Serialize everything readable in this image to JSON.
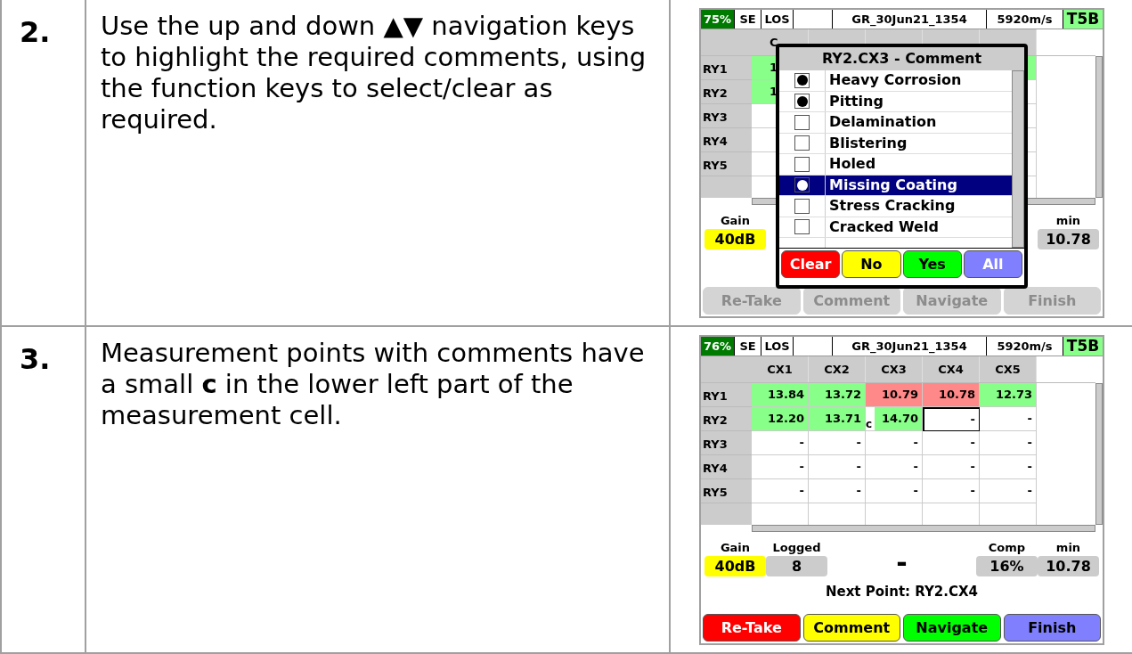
{
  "steps": [
    {
      "number": "2.",
      "text": "Use the up and down ▲▼ navigation keys to highlight the required comments, using the function keys to select/clear as required.",
      "screen": {
        "status": {
          "battery": "75%",
          "mode": "SE",
          "probe": "LOS",
          "file": "GR_30Jun21_1354",
          "velocity": "5920m/s",
          "transducer": "T5B"
        },
        "columns": [
          "C"
        ],
        "rows": [
          {
            "label": "RY1",
            "cells": [
              {
                "value": "1",
                "color": "#88ff88"
              },
              {},
              {},
              {},
              {
                "color": "#88ff88"
              }
            ]
          },
          {
            "label": "RY2",
            "cells": [
              {
                "value": "1",
                "color": "#88ff88"
              }
            ]
          },
          {
            "label": "RY3",
            "cells": []
          },
          {
            "label": "RY4",
            "cells": []
          },
          {
            "label": "RY5",
            "cells": []
          }
        ],
        "stats": [
          {
            "kind": "gain",
            "label": "Gain",
            "value": "40dB"
          },
          {
            "kind": "value",
            "label": "min",
            "value": "10.78"
          }
        ],
        "modal": {
          "title": "RY2.CX3 - Comment",
          "items": [
            {
              "label": "Heavy Corrosion",
              "checked": true,
              "selected": false
            },
            {
              "label": "Pitting",
              "checked": true,
              "selected": false
            },
            {
              "label": "Delamination",
              "checked": false,
              "selected": false
            },
            {
              "label": "Blistering",
              "checked": false,
              "selected": false
            },
            {
              "label": "Holed",
              "checked": false,
              "selected": false
            },
            {
              "label": "Missing Coating",
              "checked": true,
              "selected": true
            },
            {
              "label": "Stress Cracking",
              "checked": false,
              "selected": false
            },
            {
              "label": "Cracked Weld",
              "checked": false,
              "selected": false
            }
          ],
          "buttons": [
            {
              "label": "Clear",
              "kind": "danger"
            },
            {
              "label": "No",
              "kind": "warning"
            },
            {
              "label": "Yes",
              "kind": "confirm"
            },
            {
              "label": "All",
              "kind": "accent"
            }
          ]
        },
        "buttons": [
          {
            "label": "Re-Take",
            "disabled": true
          },
          {
            "label": "Comment",
            "disabled": true
          },
          {
            "label": "Navigate",
            "disabled": true
          },
          {
            "label": "Finish",
            "disabled": true
          }
        ]
      }
    },
    {
      "number": "3.",
      "text": "Measurement points with comments have a small **c** in the lower left part of the measurement cell.",
      "screen": {
        "status": {
          "battery": "76%",
          "mode": "SE",
          "probe": "LOS",
          "file": "GR_30Jun21_1354",
          "velocity": "5920m/s",
          "transducer": "T5B"
        },
        "columns": [
          "CX1",
          "CX2",
          "CX3",
          "CX4",
          "CX5"
        ],
        "rows": [
          {
            "label": "RY1",
            "cells": [
              {
                "value": "13.84",
                "color": "#88ff88",
                "selected": false
              },
              {
                "value": "13.72",
                "color": "#88ff88",
                "selected": false
              },
              {
                "value": "10.79",
                "color": "#ff8888",
                "selected": false
              },
              {
                "value": "10.78",
                "color": "#ff8888",
                "selected": false
              },
              {
                "value": "12.73",
                "color": "#88ff88",
                "selected": false
              }
            ]
          },
          {
            "label": "RY2",
            "cells": [
              {
                "value": "12.20",
                "color": "#88ff88",
                "selected": false
              },
              {
                "value": "13.71",
                "color": "#88ff88",
                "selected": false
              },
              {
                "value": "14.70",
                "color": "#88ff88",
                "comment": "c",
                "selected": false
              },
              {
                "value": "-",
                "selected": true
              },
              {
                "value": "-",
                "selected": false
              }
            ]
          },
          {
            "label": "RY3",
            "cells": [
              {
                "value": "-",
                "selected": false
              },
              {
                "value": "-",
                "selected": false
              },
              {
                "value": "-",
                "selected": false
              },
              {
                "value": "-",
                "selected": false
              },
              {
                "value": "-",
                "selected": false
              }
            ]
          },
          {
            "label": "RY4",
            "cells": [
              {
                "value": "-",
                "selected": false
              },
              {
                "value": "-",
                "selected": false
              },
              {
                "value": "-",
                "selected": false
              },
              {
                "value": "-",
                "selected": false
              },
              {
                "value": "-",
                "selected": false
              }
            ]
          },
          {
            "label": "RY5",
            "cells": [
              {
                "value": "-",
                "selected": false
              },
              {
                "value": "-",
                "selected": false
              },
              {
                "value": "-",
                "selected": false
              },
              {
                "value": "-",
                "selected": false
              },
              {
                "value": "-",
                "selected": false
              }
            ]
          }
        ],
        "stats": [
          {
            "kind": "gain",
            "label": "Gain",
            "value": "40dB"
          },
          {
            "kind": "value",
            "label": "Logged",
            "value": "8"
          },
          {
            "kind": "reading",
            "value": "-"
          },
          {
            "kind": "value",
            "label": "Comp",
            "value": "16%"
          },
          {
            "kind": "value",
            "label": "min",
            "value": "10.78"
          }
        ],
        "next_point": "Next Point: RY2.CX4",
        "buttons": [
          {
            "label": "Re-Take",
            "kind": "danger",
            "disabled": false
          },
          {
            "label": "Comment",
            "kind": "warning",
            "disabled": false
          },
          {
            "label": "Navigate",
            "kind": "confirm",
            "disabled": false
          },
          {
            "label": "Finish",
            "kind": "finish",
            "disabled": false
          }
        ]
      }
    }
  ]
}
